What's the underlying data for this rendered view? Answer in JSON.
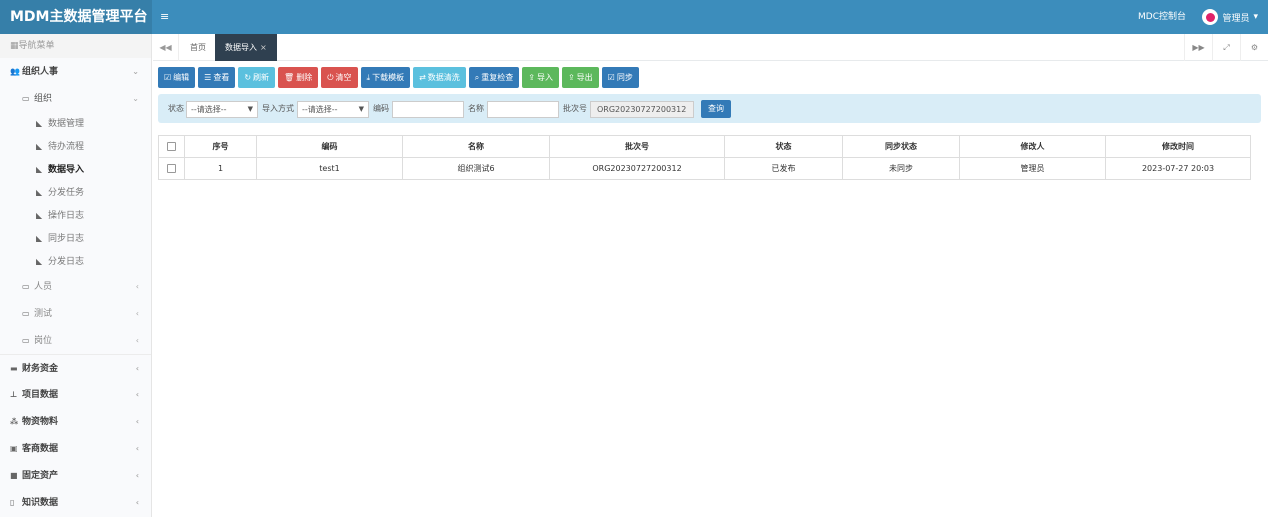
{
  "header": {
    "logo": "MDM主数据管理平台",
    "menu_icon": "≡",
    "console": "MDC控制台",
    "user": "管理员"
  },
  "sidebar": {
    "nav_header": "导航菜单",
    "groups": [
      {
        "label": "组织人事"
      },
      {
        "label": "组织"
      },
      {
        "label": "数据管理"
      },
      {
        "label": "待办流程"
      },
      {
        "label": "数据导入"
      },
      {
        "label": "分发任务"
      },
      {
        "label": "操作日志"
      },
      {
        "label": "同步日志"
      },
      {
        "label": "分发日志"
      },
      {
        "label": "人员"
      },
      {
        "label": "测试"
      },
      {
        "label": "岗位"
      },
      {
        "label": "财务资金"
      },
      {
        "label": "项目数据"
      },
      {
        "label": "物资物料"
      },
      {
        "label": "客商数据"
      },
      {
        "label": "固定资产"
      },
      {
        "label": "知识数据"
      }
    ]
  },
  "tabs": {
    "home": "首页",
    "active": "数据导入"
  },
  "toolbar": [
    {
      "label": "编辑",
      "icon": "☑"
    },
    {
      "label": "查看",
      "icon": "☰"
    },
    {
      "label": "刷新",
      "icon": "↻"
    },
    {
      "label": "删除",
      "icon": "🗑"
    },
    {
      "label": "清空",
      "icon": "⏻"
    },
    {
      "label": "下载模板",
      "icon": "⤓"
    },
    {
      "label": "数据清洗",
      "icon": "⇄"
    },
    {
      "label": "重复检查",
      "icon": "⌕"
    },
    {
      "label": "导入",
      "icon": "⇪"
    },
    {
      "label": "导出",
      "icon": "⇪"
    },
    {
      "label": "同步",
      "icon": "☑"
    }
  ],
  "search": {
    "status_label": "状态",
    "status_value": "--请选择--",
    "import_label": "导入方式",
    "import_value": "--请选择--",
    "code_label": "编码",
    "name_label": "名称",
    "batch_label": "批次号",
    "batch_value": "ORG20230727200312",
    "query_btn": "查询"
  },
  "table": {
    "headers": [
      "序号",
      "编码",
      "名称",
      "批次号",
      "状态",
      "同步状态",
      "修改人",
      "修改时间"
    ],
    "rows": [
      [
        "1",
        "test1",
        "组织测试6",
        "ORG20230727200312",
        "已发布",
        "未同步",
        "管理员",
        "2023-07-27 20:03"
      ]
    ]
  },
  "colors": {
    "header": "#3c8dbc",
    "logo_bg": "#367fa9",
    "active_tab": "#2f4050",
    "primary": "#337ab7",
    "info": "#5bc0de",
    "danger": "#d9534f",
    "success": "#5cb85c",
    "search_bg": "#d9edf7"
  }
}
